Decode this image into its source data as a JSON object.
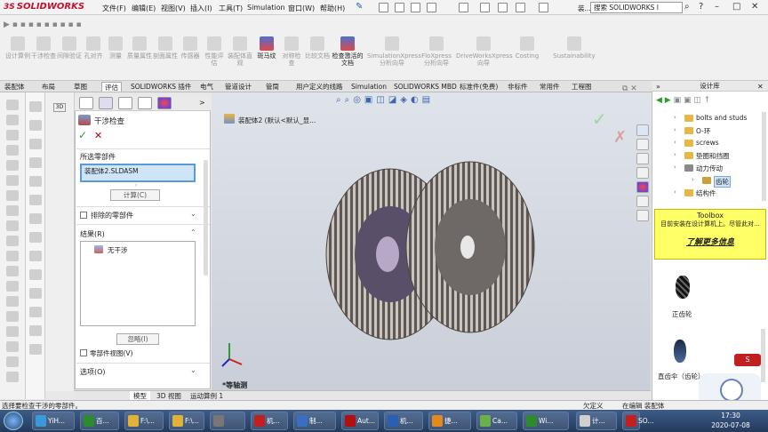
{
  "app": {
    "brand": "SOLIDWORKS",
    "brand_prefix": "3S"
  },
  "menu": [
    "文件(F)",
    "编辑(E)",
    "视图(V)",
    "插入(I)",
    "工具(T)",
    "Simulation",
    "窗口(W)",
    "帮助(H)"
  ],
  "title_fragment": "装...",
  "search": {
    "placeholder": "搜索 SOLIDWORKS I"
  },
  "window_controls": {
    "help": "?",
    "minimize": "–",
    "restore": "□",
    "close": "✕"
  },
  "command_manager": [
    {
      "label": "设计算例",
      "enabled": false
    },
    {
      "label": "干涉检查",
      "enabled": false
    },
    {
      "label": "间隙验证",
      "enabled": false
    },
    {
      "label": "孔对齐",
      "enabled": false
    },
    {
      "label": "测量",
      "enabled": false
    },
    {
      "label": "质量属性",
      "enabled": false
    },
    {
      "label": "剖面属性",
      "enabled": false
    },
    {
      "label": "传感器",
      "enabled": false
    },
    {
      "label": "性能评估",
      "enabled": false
    },
    {
      "label": "装配体直观",
      "enabled": false
    },
    {
      "label": "斑马纹",
      "enabled": true
    },
    {
      "label": "对称检查",
      "enabled": false
    },
    {
      "label": "比较文档",
      "enabled": false
    },
    {
      "label": "检查激活的文档",
      "enabled": true
    },
    {
      "label": "SimulationXpress 分析向导",
      "enabled": false
    },
    {
      "label": "FloXpress 分析向导",
      "enabled": false
    },
    {
      "label": "DriveWorksXpress 向导",
      "enabled": false
    },
    {
      "label": "Costing",
      "enabled": false
    },
    {
      "label": "Sustainability",
      "enabled": false
    }
  ],
  "tabs": [
    "装配体",
    "布局",
    "草图",
    "评估",
    "SOLIDWORKS 插件",
    "电气",
    "管道设计",
    "管筒",
    "用户定义的线路",
    "Simulation",
    "SOLIDWORKS MBD",
    "标准件(免费)",
    "非标件",
    "常用件",
    "工程图"
  ],
  "active_tab": "评估",
  "property_manager": {
    "title": "干涉检查",
    "ok": "✓",
    "cancel": "✕",
    "selected_components_header": "所选零部件",
    "selected_item": "装配体2.SLDASM",
    "calculate_button": "计算(C)",
    "excluded_header": "排除的零部件",
    "results_header": "结果(R)",
    "result_item": "无干涉",
    "ignore_button": "忽略(I)",
    "component_view_label": "零部件视图(V)",
    "options_header": "选项(O)"
  },
  "viewport": {
    "tree_label": "装配体2 (默认<默认_显...",
    "view_label": "*等轴测"
  },
  "bottom_tabs": [
    "模型",
    "3D 视图",
    "运动算例 1"
  ],
  "status": {
    "left": "选择要检查干涉的零部件。",
    "mid": "欠定义",
    "right": "在编辑 装配体"
  },
  "design_library": {
    "title": "设计库",
    "tree": [
      "bolts and studs",
      "O-环",
      "screws",
      "垫圈和挡圈",
      "动力传动",
      "齿轮",
      "结构件"
    ],
    "selected": "齿轮",
    "toolbox": {
      "title": "Toolbox",
      "message": "目前安装在设计算机上。尽管此对...",
      "link": "了解更多信息"
    },
    "items": [
      "正齿轮",
      "直齿伞（齿轮）"
    ]
  },
  "taskbar": {
    "tasks": [
      "YiH...",
      "百...",
      "F:\\...",
      "F:\\...",
      "",
      "机...",
      "制...",
      "Aut...",
      "机...",
      "捷...",
      "Ca...",
      "Wi...",
      "计...",
      "SO..."
    ],
    "time": "17:30",
    "date": "2020-07-08"
  },
  "colors": {
    "brand_red": "#c8102e",
    "selection_blue": "#5b9bd5",
    "toolbox_yellow": "#ffff66",
    "taskbar_blue": "#2f4a72"
  }
}
